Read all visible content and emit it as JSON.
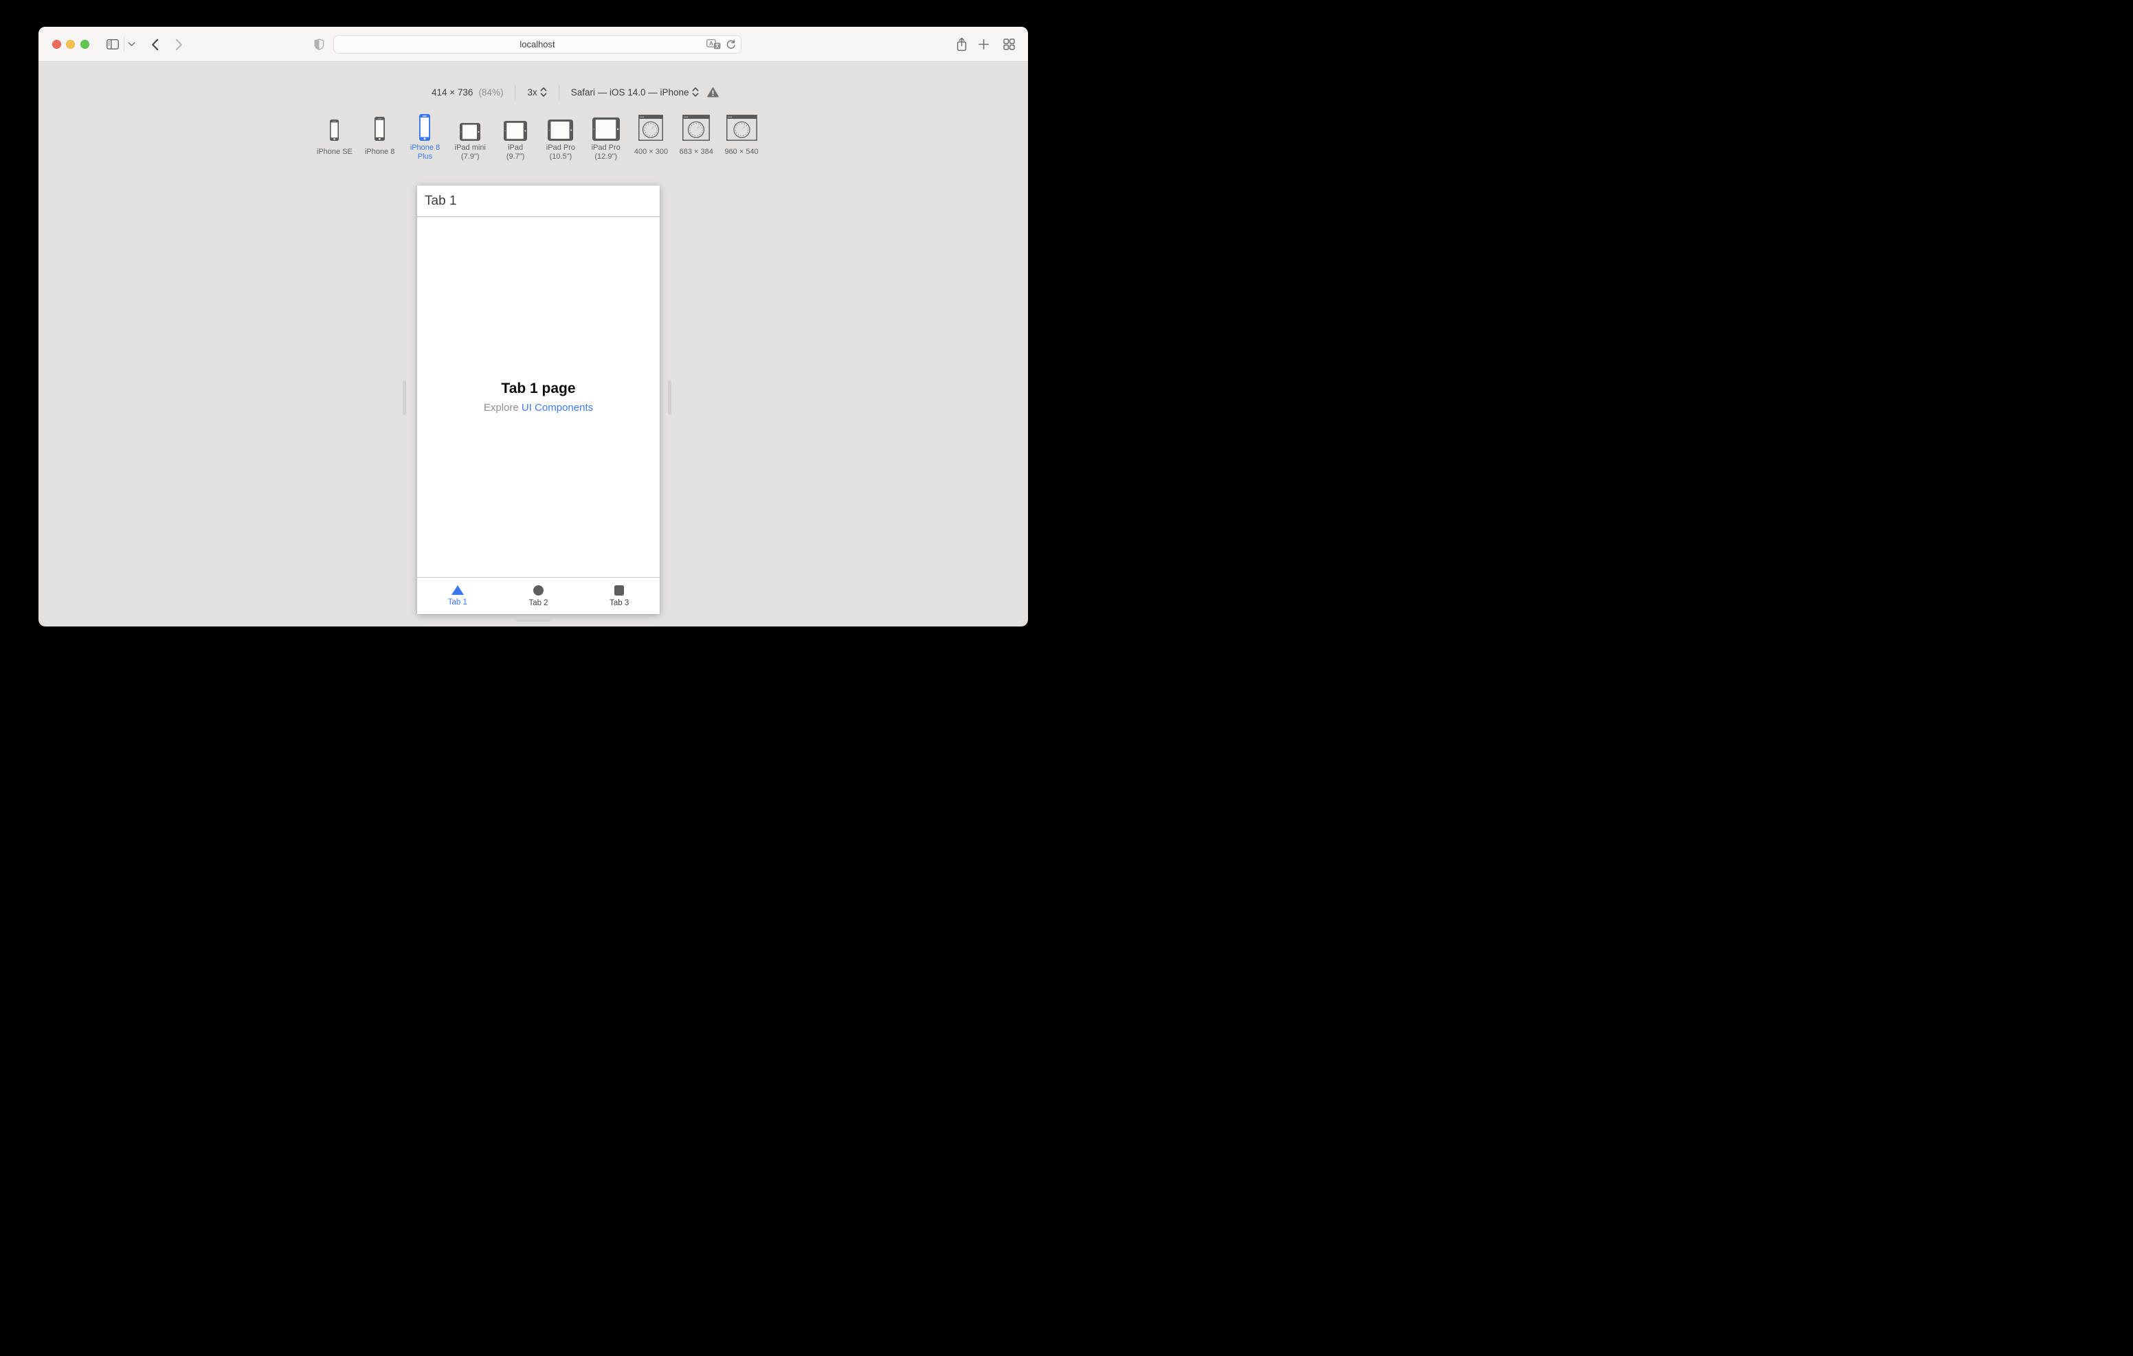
{
  "colors": {
    "accent": "#3a76ef",
    "link": "#3e7bf1"
  },
  "browser_chrome": {
    "url": "localhost",
    "icons": {
      "traffic_lights": [
        "close",
        "minimize",
        "zoom"
      ],
      "left": [
        "sidebar",
        "chevron-down",
        "back",
        "forward"
      ],
      "address": [
        "privacy-shield",
        "translate",
        "reload"
      ],
      "right": [
        "share",
        "new-tab",
        "tab-overview"
      ]
    }
  },
  "rdm": {
    "size": "414 × 736",
    "zoom": "(84%)",
    "pixel_ratio": "3x",
    "user_agent": "Safari — iOS 14.0 — iPhone",
    "warning_icon": "warning-triangle",
    "devices": [
      {
        "line1": "iPhone SE",
        "line2": "",
        "type": "phone-se",
        "selected": false
      },
      {
        "line1": "iPhone 8",
        "line2": "",
        "type": "phone-8",
        "selected": false
      },
      {
        "line1": "iPhone 8",
        "line2": "Plus",
        "type": "phone-8plus",
        "selected": true
      },
      {
        "line1": "iPad mini",
        "line2": "(7.9\")",
        "type": "ipad-mini",
        "selected": false
      },
      {
        "line1": "iPad",
        "line2": "(9.7\")",
        "type": "ipad",
        "selected": false
      },
      {
        "line1": "iPad Pro",
        "line2": "(10.5\")",
        "type": "ipad-pro-105",
        "selected": false
      },
      {
        "line1": "iPad Pro",
        "line2": "(12.9\")",
        "type": "ipad-pro-129",
        "selected": false
      },
      {
        "line1": "400 × 300",
        "line2": "",
        "type": "browser-400",
        "selected": false
      },
      {
        "line1": "683 × 384",
        "line2": "",
        "type": "browser-683",
        "selected": false
      },
      {
        "line1": "960 × 540",
        "line2": "",
        "type": "browser-960",
        "selected": false
      }
    ]
  },
  "app": {
    "nav_title": "Tab 1",
    "heading": "Tab 1 page",
    "subtitle_prefix": "Explore ",
    "subtitle_link": "UI Components",
    "tabs": [
      {
        "label": "Tab 1",
        "shape": "triangle",
        "active": true
      },
      {
        "label": "Tab 2",
        "shape": "circle",
        "active": false
      },
      {
        "label": "Tab 3",
        "shape": "square",
        "active": false
      }
    ]
  }
}
